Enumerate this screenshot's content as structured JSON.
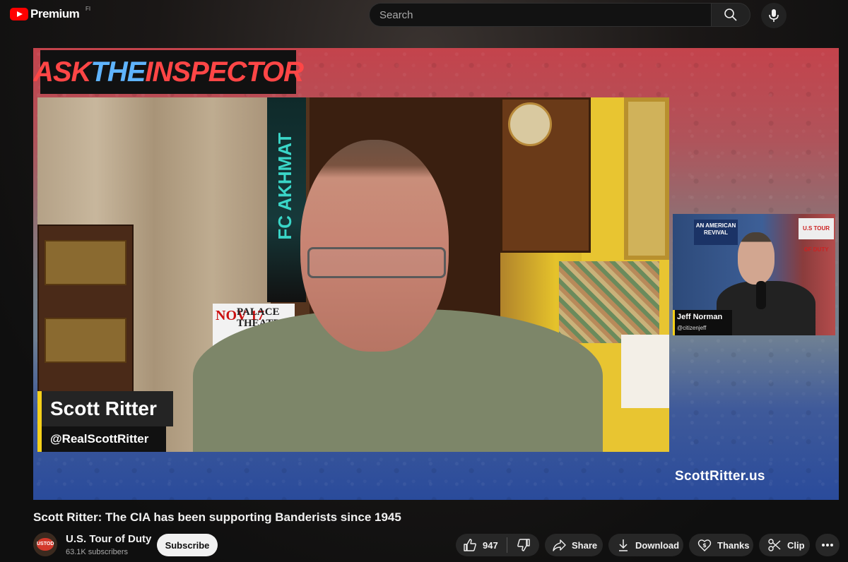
{
  "header": {
    "logo_text": "Premium",
    "country_code": "FI",
    "search_placeholder": "Search"
  },
  "video": {
    "banner_part1": "ASK ",
    "banner_part2": "THE ",
    "banner_part3": "INSPECTOR",
    "main_guest_name": "Scott Ritter",
    "main_guest_handle": "@RealScottRitter",
    "side_guest_name": "Jeff Norman",
    "side_guest_handle": "@citizenjeff",
    "watermark": "ScottRitter.us",
    "scene_scarf_text": "FC AKHMAT",
    "scene_poster_num": "NOV 17",
    "scene_poster_text": "PALACE THEATRE",
    "scene_sign_text": "AN AMERICAN REVIVAL",
    "scene_usd_text": "U.S TOUR OF DUTY",
    "avatar_text": "USTOD"
  },
  "meta": {
    "title": "Scott Ritter: The CIA has been supporting Banderists since 1945",
    "channel_name": "U.S. Tour of Duty",
    "subscribers": "63.1K subscribers",
    "subscribe_label": "Subscribe"
  },
  "actions": {
    "like_count": "947",
    "share_label": "Share",
    "download_label": "Download",
    "thanks_label": "Thanks",
    "clip_label": "Clip"
  },
  "colors": {
    "accent_red": "#ff0000",
    "lower_third_yellow": "#f5d019",
    "banner_red": "#ff4646",
    "banner_blue": "#5fb4ff"
  }
}
